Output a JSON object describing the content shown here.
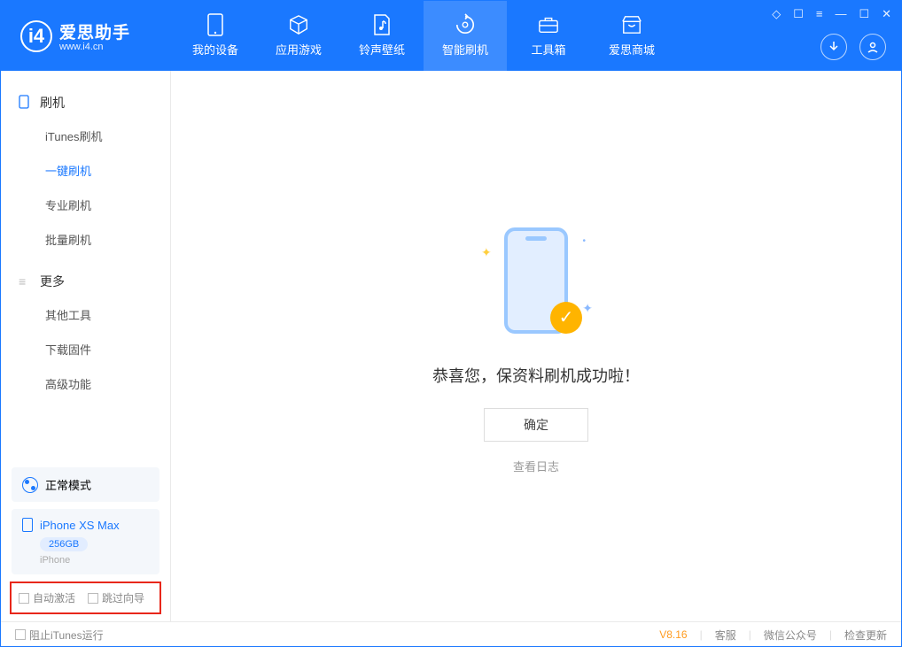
{
  "app": {
    "title": "爱思助手",
    "subtitle": "www.i4.cn"
  },
  "nav": {
    "tabs": [
      {
        "label": "我的设备"
      },
      {
        "label": "应用游戏"
      },
      {
        "label": "铃声壁纸"
      },
      {
        "label": "智能刷机"
      },
      {
        "label": "工具箱"
      },
      {
        "label": "爱思商城"
      }
    ]
  },
  "sidebar": {
    "section1_title": "刷机",
    "items1": [
      {
        "label": "iTunes刷机"
      },
      {
        "label": "一键刷机"
      },
      {
        "label": "专业刷机"
      },
      {
        "label": "批量刷机"
      }
    ],
    "section2_title": "更多",
    "items2": [
      {
        "label": "其他工具"
      },
      {
        "label": "下载固件"
      },
      {
        "label": "高级功能"
      }
    ],
    "mode_label": "正常模式",
    "device": {
      "name": "iPhone XS Max",
      "capacity": "256GB",
      "type": "iPhone"
    },
    "chk_auto_activate": "自动激活",
    "chk_skip_guide": "跳过向导"
  },
  "main": {
    "success_message": "恭喜您，保资料刷机成功啦！",
    "ok_button": "确定",
    "view_log": "查看日志"
  },
  "footer": {
    "block_itunes": "阻止iTunes运行",
    "version": "V8.16",
    "links": [
      "客服",
      "微信公众号",
      "检查更新"
    ]
  }
}
